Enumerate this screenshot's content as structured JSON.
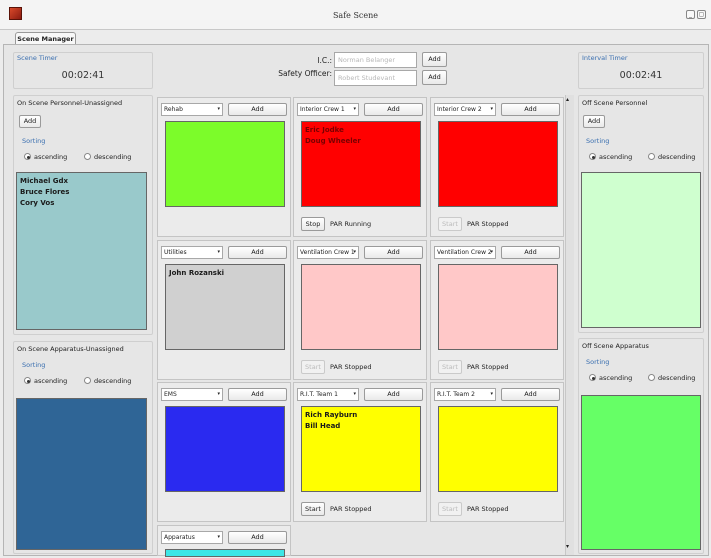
{
  "window": {
    "title": "Safe Scene",
    "minimize": "_",
    "maximize": "▢"
  },
  "tab": {
    "label": "Scene Manager"
  },
  "header": {
    "scene_timer_label": "Scene Timer",
    "scene_timer_value": "00:02:41",
    "ic_label": "I.C.:",
    "ic_placeholder": "Norman Belanger",
    "safety_label": "Safety Officer:",
    "safety_placeholder": "Robert Studevant",
    "add": "Add",
    "interval_timer_label": "Interval Timer",
    "interval_timer_value": "00:02:41"
  },
  "left": {
    "personnel_title": "On Scene Personnel-Unassigned",
    "add": "Add",
    "sorting": "Sorting",
    "ascending": "ascending",
    "descending": "descending",
    "personnel": [
      "Michael Gdx",
      "Bruce Flores",
      "Cory Vos"
    ],
    "apparatus_title": "On Scene Apparatus-Unassigned"
  },
  "right": {
    "personnel_title": "Off Scene Personnel",
    "add": "Add",
    "sorting": "Sorting",
    "ascending": "ascending",
    "descending": "descending",
    "apparatus_title": "Off Scene Apparatus"
  },
  "crews": [
    {
      "name": "Rehab",
      "add": "Add",
      "color": "#7cfc2a",
      "members": [],
      "controls": false
    },
    {
      "name": "Interior Crew 1",
      "add": "Add",
      "color": "#ff0000",
      "members": [
        "Eric Jodke",
        "Doug Wheeler"
      ],
      "controls": true,
      "btn": "Stop",
      "btn_enabled": true,
      "status": "PAR Running"
    },
    {
      "name": "Interior Crew 2",
      "add": "Add",
      "color": "#ff0000",
      "members": [],
      "controls": true,
      "btn": "Start",
      "btn_enabled": false,
      "status": "PAR Stopped"
    },
    {
      "name": "Utilities",
      "add": "Add",
      "color": "#d0d0d0",
      "members": [
        "John Rozanski"
      ],
      "controls": false
    },
    {
      "name": "Ventilation Crew 1",
      "add": "Add",
      "color": "#ffc8c8",
      "members": [],
      "controls": true,
      "btn": "Start",
      "btn_enabled": false,
      "status": "PAR Stopped"
    },
    {
      "name": "Ventilation Crew 2",
      "add": "Add",
      "color": "#ffc8c8",
      "members": [],
      "controls": true,
      "btn": "Start",
      "btn_enabled": false,
      "status": "PAR Stopped"
    },
    {
      "name": "EMS",
      "add": "Add",
      "color": "#2a2af0",
      "members": [],
      "controls": false
    },
    {
      "name": "R.I.T. Team 1",
      "add": "Add",
      "color": "#ffff00",
      "members": [
        "Rich Rayburn",
        "Bill Head"
      ],
      "controls": true,
      "btn": "Start",
      "btn_enabled": true,
      "status": "PAR Stopped"
    },
    {
      "name": "R.I.T. Team 2",
      "add": "Add",
      "color": "#ffff00",
      "members": [],
      "controls": true,
      "btn": "Start",
      "btn_enabled": false,
      "status": "PAR Stopped"
    },
    {
      "name": "Apparatus",
      "add": "Add",
      "color": "#3ee6e6",
      "members": [],
      "controls": false
    }
  ],
  "colors": {
    "unassigned_personnel": "#99c9cb",
    "unassigned_apparatus": "#2f6596",
    "off_personnel": "#cfffcf",
    "off_apparatus": "#66ff66"
  }
}
